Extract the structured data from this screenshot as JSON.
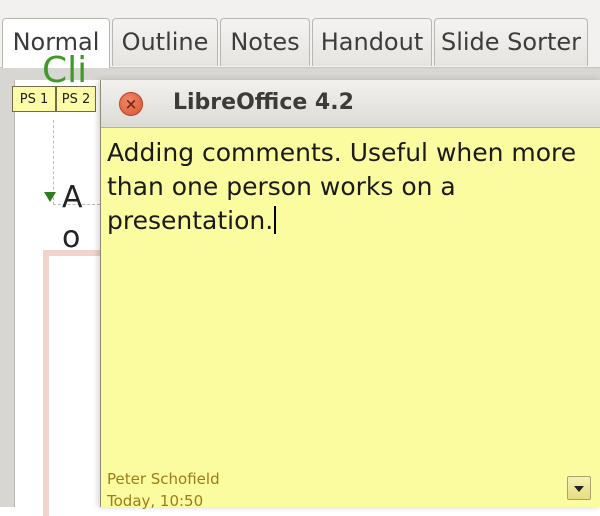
{
  "tabs": [
    {
      "label": "Normal"
    },
    {
      "label": "Outline"
    },
    {
      "label": "Notes"
    },
    {
      "label": "Handout"
    },
    {
      "label": "Slide Sorter"
    }
  ],
  "active_tab": "Normal",
  "comment_markers": [
    {
      "label": "PS 1"
    },
    {
      "label": "PS 2"
    }
  ],
  "slide": {
    "title_fragment": "Cli",
    "bullet_fragment": "A o"
  },
  "note": {
    "window_title": "LibreOffice 4.2",
    "text": "Adding comments. Useful when more than one person works on a presentation.",
    "author": "Peter Schofield",
    "time": "Today, 10:50"
  },
  "colors": {
    "note_background": "#fbfba0",
    "slide_title_green": "#3f9a2a",
    "author_text": "#9a7e1a"
  }
}
